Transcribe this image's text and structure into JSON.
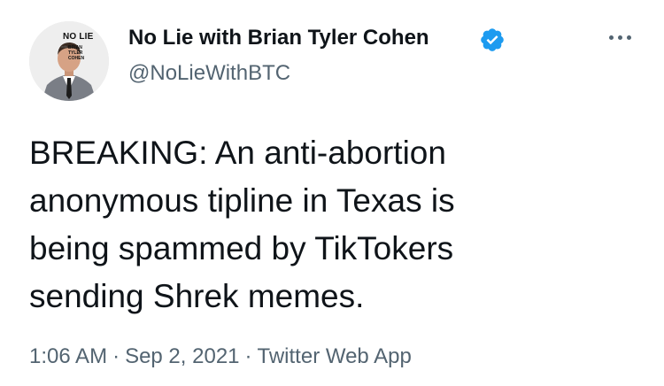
{
  "author": {
    "display_name": "No Lie with Brian Tyler Cohen",
    "handle": "@NoLieWithBTC",
    "verified_icon": "verified-badge-icon",
    "avatar_logo": {
      "main": "NO LIE",
      "with": "with",
      "sub": [
        "BRIAN",
        "TYLER",
        "COHEN"
      ]
    }
  },
  "tweet": {
    "lines": [
      "BREAKING: An anti-abortion",
      "anonymous tipline in Texas is",
      "being spammed by TikTokers",
      "sending Shrek memes."
    ]
  },
  "meta": {
    "time": "1:06 AM",
    "separator": "·",
    "date": "Sep 2, 2021",
    "source": "Twitter Web App"
  },
  "colors": {
    "text_primary": "#0f1419",
    "text_secondary": "#536471",
    "verified_blue": "#1d9bf0",
    "background": "#ffffff"
  }
}
